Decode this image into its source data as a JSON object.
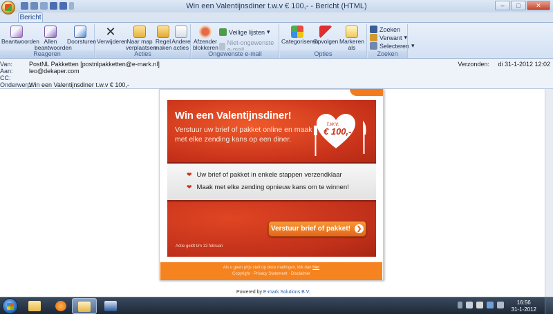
{
  "window": {
    "title": "Win een Valentijnsdiner t.w.v € 100,- - Bericht (HTML)",
    "controls": [
      "–",
      "□",
      "✕"
    ]
  },
  "ribbon": {
    "active_tab": "Bericht",
    "groups": {
      "reageren": {
        "label": "Reageren",
        "buttons": [
          "Beantwoorden",
          "Allen beantwoorden",
          "Doorsturen"
        ]
      },
      "acties": {
        "label": "Acties",
        "buttons": [
          "Verwijderen",
          "Naar map verplaatsen",
          "Regel maken",
          "Andere acties"
        ]
      },
      "ongewenste": {
        "label": "Ongewenste e-mail",
        "buttons": [
          "Afzender blokkeren"
        ],
        "small": [
          "Veilige lijsten",
          "Niet-ongewenste e-mail"
        ]
      },
      "opties": {
        "label": "Opties",
        "buttons": [
          "Categoriseren",
          "Opvolgen",
          "Markeren als ongelezen"
        ]
      },
      "zoeken": {
        "label": "Zoeken",
        "small": [
          "Zoeken",
          "Verwant",
          "Selecteren"
        ]
      }
    }
  },
  "headers": {
    "from_label": "Van:",
    "from": "PostNL Pakketten [postnlpakketten@e-mark.nl]",
    "to_label": "Aan:",
    "to": "leo@dekaper.com",
    "cc_label": "CC:",
    "cc": "",
    "subject_label": "Onderwerp:",
    "subject": "Win een Valentijnsdiner t.w.v € 100,-",
    "sent_label": "Verzonden:",
    "sent": "di 31-1-2012 12:02"
  },
  "email": {
    "headline": "Win een Valentijnsdiner!",
    "subline": "Verstuur uw brief of pakket online en maak met elke zending kans op een diner.",
    "heart_small": "t.w.v.",
    "heart_amount": "€ 100,-",
    "bullets": [
      "Uw brief of pakket in enkele stappen verzendklaar",
      "Maak met elke zending opnieuw kans om te winnen!"
    ],
    "cta": "Verstuur brief of pakket!",
    "note": "Actie geldt t/m 13 februari",
    "footer_line1": "Als u geen prijs stelt op deze mailingen, klik dan",
    "footer_link": "hier",
    "footer_line2": "Copyright · Privacy Statement · Disclaimer",
    "powered_prefix": "Powered by",
    "powered_link": "E-mark Solutions B.V."
  },
  "taskbar": {
    "time": "16:56",
    "date": "31-1-2012"
  },
  "colors": {
    "accent_orange": "#f5831f",
    "banner_red": "#c8321a",
    "ribbon_blue": "#d3e1f3"
  }
}
